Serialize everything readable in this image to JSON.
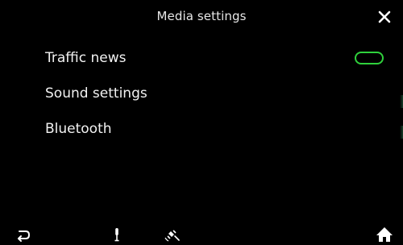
{
  "header": {
    "title": "Media settings",
    "close_icon": "close-icon"
  },
  "menu": {
    "items": [
      {
        "label": "Traffic news",
        "toggle": "off"
      },
      {
        "label": "Sound settings"
      },
      {
        "label": "Bluetooth"
      }
    ]
  },
  "footer": {
    "icons": [
      "back-icon",
      "microphone-icon",
      "satellite-icon",
      "home-icon"
    ]
  },
  "colors": {
    "background": "#000000",
    "text": "#f2f2f2",
    "toggle_accent": "#2fd13c"
  }
}
